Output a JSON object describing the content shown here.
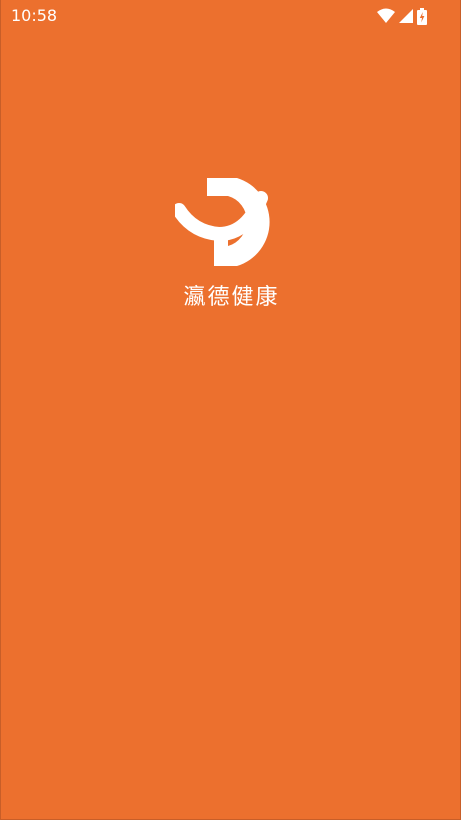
{
  "status_bar": {
    "time": "10:58",
    "icons": [
      "wifi-icon",
      "cellular-signal-icon",
      "battery-charging-icon"
    ]
  },
  "splash": {
    "logo_icon": "yd-logo-icon",
    "app_name": "瀛德健康"
  },
  "colors": {
    "background": "#EC702E",
    "foreground": "#FFFFFF"
  }
}
